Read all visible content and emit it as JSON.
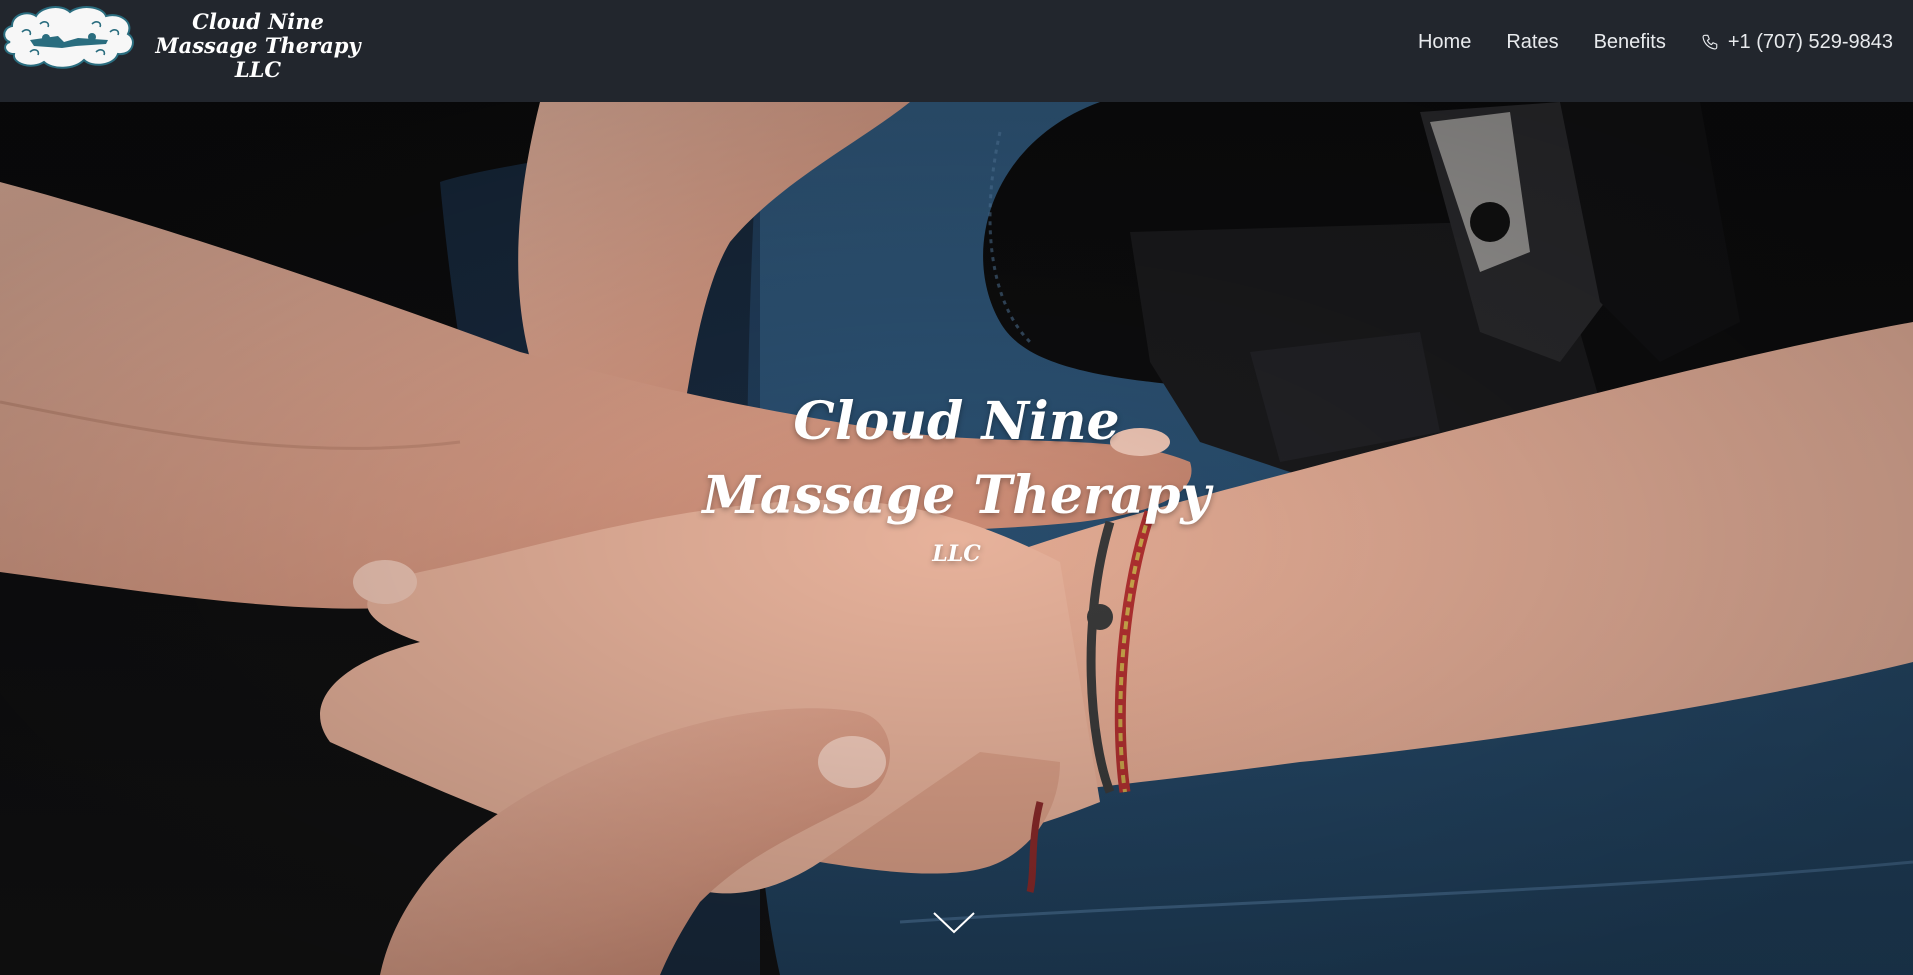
{
  "header": {
    "brand": {
      "line1": "Cloud Nine",
      "line2": "Massage Therapy",
      "line3": "LLC"
    },
    "logo_icon": "cloud-logo-icon",
    "nav": {
      "home": "Home",
      "rates": "Rates",
      "benefits": "Benefits",
      "phone": "+1 (707) 529-9843"
    },
    "phone_icon": "phone-icon"
  },
  "hero": {
    "title_line1": "Cloud Nine",
    "title_line2": "Massage Therapy",
    "title_line3": "LLC",
    "scroll_icon": "chevron-down-icon"
  },
  "colors": {
    "header_bg": "#22262d",
    "table_blue": "#2b5274",
    "logo_teal": "#2a6d7f",
    "text_white": "#ffffff"
  }
}
